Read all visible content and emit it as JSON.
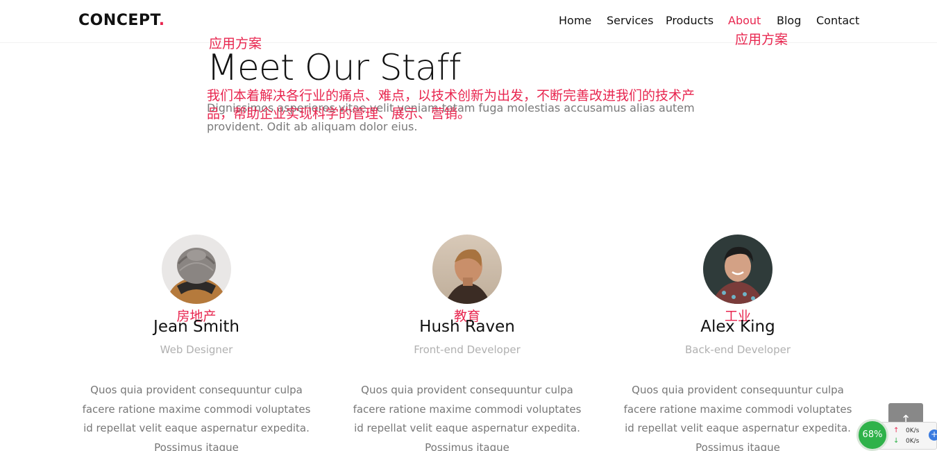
{
  "header": {
    "logo_text": "CONCEPT",
    "logo_dot": ".",
    "nav": [
      "Home",
      "Services",
      "Products",
      "About",
      "Blog",
      "Contact"
    ],
    "active_nav": "About"
  },
  "overlay_notes": {
    "title_tag": "应用方案",
    "nav_tag": "应用方案",
    "lead": "我们本着解决各行业的痛点、难点，以技术创新为出发，不断完善改进我们的技术产品，帮助企业实现科学的管理、展示、营销。"
  },
  "hero": {
    "title": "Meet Our Staff",
    "lead": "Dignissimos asperiores vitae velit veniam totam fuga molestias accusamus alias autem provident. Odit ab aliquam dolor eius."
  },
  "staff": [
    {
      "tag": "房地产",
      "name": "Jean Smith",
      "role": "Web Designer",
      "bio": "Quos quia provident consequuntur culpa facere ratione maxime commodi voluptates id repellat velit eaque aspernatur expedita. Possimus itaque",
      "avatar_icon": "beanie-person-avatar"
    },
    {
      "tag": "教育",
      "name": "Hush Raven",
      "role": "Front-end Developer",
      "bio": "Quos quia provident consequuntur culpa facere ratione maxime commodi voluptates id repellat velit eaque aspernatur expedita. Possimus itaque",
      "avatar_icon": "profile-man-avatar"
    },
    {
      "tag": "工业",
      "name": "Alex King",
      "role": "Back-end Developer",
      "bio": "Quos quia provident consequuntur culpa facere ratione maxime commodi voluptates id repellat velit eaque aspernatur expedita. Possimus itaque",
      "avatar_icon": "smiling-man-avatar"
    }
  ],
  "back_to_top": {
    "icon": "arrow-up-icon",
    "glyph": "↑"
  },
  "speed_widget": {
    "percent": "68%",
    "upload": "0K/s",
    "download": "0K/s"
  },
  "colors": {
    "accent": "#e8264f",
    "muted": "#777777",
    "role": "#b0b0b0"
  }
}
